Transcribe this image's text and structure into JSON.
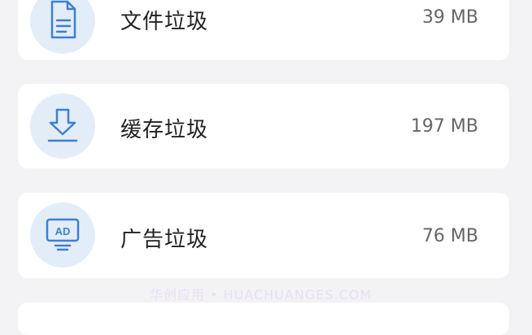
{
  "items": [
    {
      "label": "文件垃圾",
      "size": "39 MB",
      "icon": "file-document-icon"
    },
    {
      "label": "缓存垃圾",
      "size": "197 MB",
      "icon": "download-arrow-icon"
    },
    {
      "label": "广告垃圾",
      "size": "76 MB",
      "icon": "ad-monitor-icon",
      "icon_text": "AD"
    }
  ],
  "watermark": "华创应用 • HUACHUANGES.COM",
  "colors": {
    "icon_stroke": "#3d7fd0",
    "icon_bg": "#e3edf8",
    "card_bg": "#ffffff",
    "page_bg": "#f3f3f5"
  }
}
